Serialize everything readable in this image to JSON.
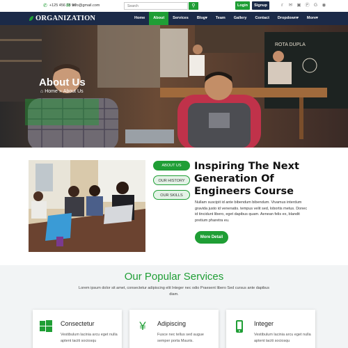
{
  "topbar": {
    "phone": "+125 456 78 90",
    "email": "info@gmail.com",
    "search_placeholder": "Search",
    "login_label": "Login",
    "signup_label": "Signup",
    "social_icons": [
      "twitter-icon",
      "email-icon",
      "instagram-icon",
      "pinterest-icon",
      "google-icon",
      "github-icon"
    ]
  },
  "nav": {
    "logo_text": "ORGANIZATION",
    "items": [
      {
        "label": "Home",
        "active": false
      },
      {
        "label": "About",
        "active": true
      },
      {
        "label": "Services",
        "active": false
      },
      {
        "label": "Blog",
        "active": false
      },
      {
        "label": "Team",
        "active": false
      },
      {
        "label": "Gallery",
        "active": false
      },
      {
        "label": "Contact",
        "active": false
      },
      {
        "label": "Dropdown",
        "active": false
      },
      {
        "label": "More",
        "active": false
      }
    ]
  },
  "hero": {
    "title": "About Us",
    "breadcrumb_home": "Home",
    "breadcrumb_sep": "»",
    "breadcrumb_current": "About Us"
  },
  "about": {
    "tabs": [
      "ABOUT US",
      "OUR HISTORY",
      "OUR SKILLS"
    ],
    "heading": "Inspiring The Next Generation Of Engineers Course",
    "text": "Nullam suscipit id ante bibendum bibendum. Vivamus interdum gravida justo id venenatis. tempus velit sed, lobortis metus. Donec id tincidunt libero, eget dapibus quam. Aenean felis ex, blandit pretium pharetra eu.",
    "button_label": "More Detail"
  },
  "services": {
    "title": "Our Popular Services",
    "subtitle": "Lorem ipsum dolor sit amet, consectetur adipiscing elit Integer nec odio Praesent libero Sed cursus ante dapibus diam.",
    "cards": [
      {
        "icon": "windows-icon",
        "title": "Consectetur",
        "text": "Vestibulum lacinia arcu eget nulla aptent taciti sociosqu"
      },
      {
        "icon": "yen-icon",
        "title": "Adipiscing",
        "text": "Fusce nec tellus sed augue semper porta Mauris."
      },
      {
        "icon": "mobile-icon",
        "title": "Integer",
        "text": "Vestibulum lacinia arcu eget nulla aptent taciti sociosqu"
      }
    ]
  },
  "colors": {
    "accent": "#1f9e35",
    "navy": "#1b2a48",
    "services_bg": "#f2f4f5"
  }
}
